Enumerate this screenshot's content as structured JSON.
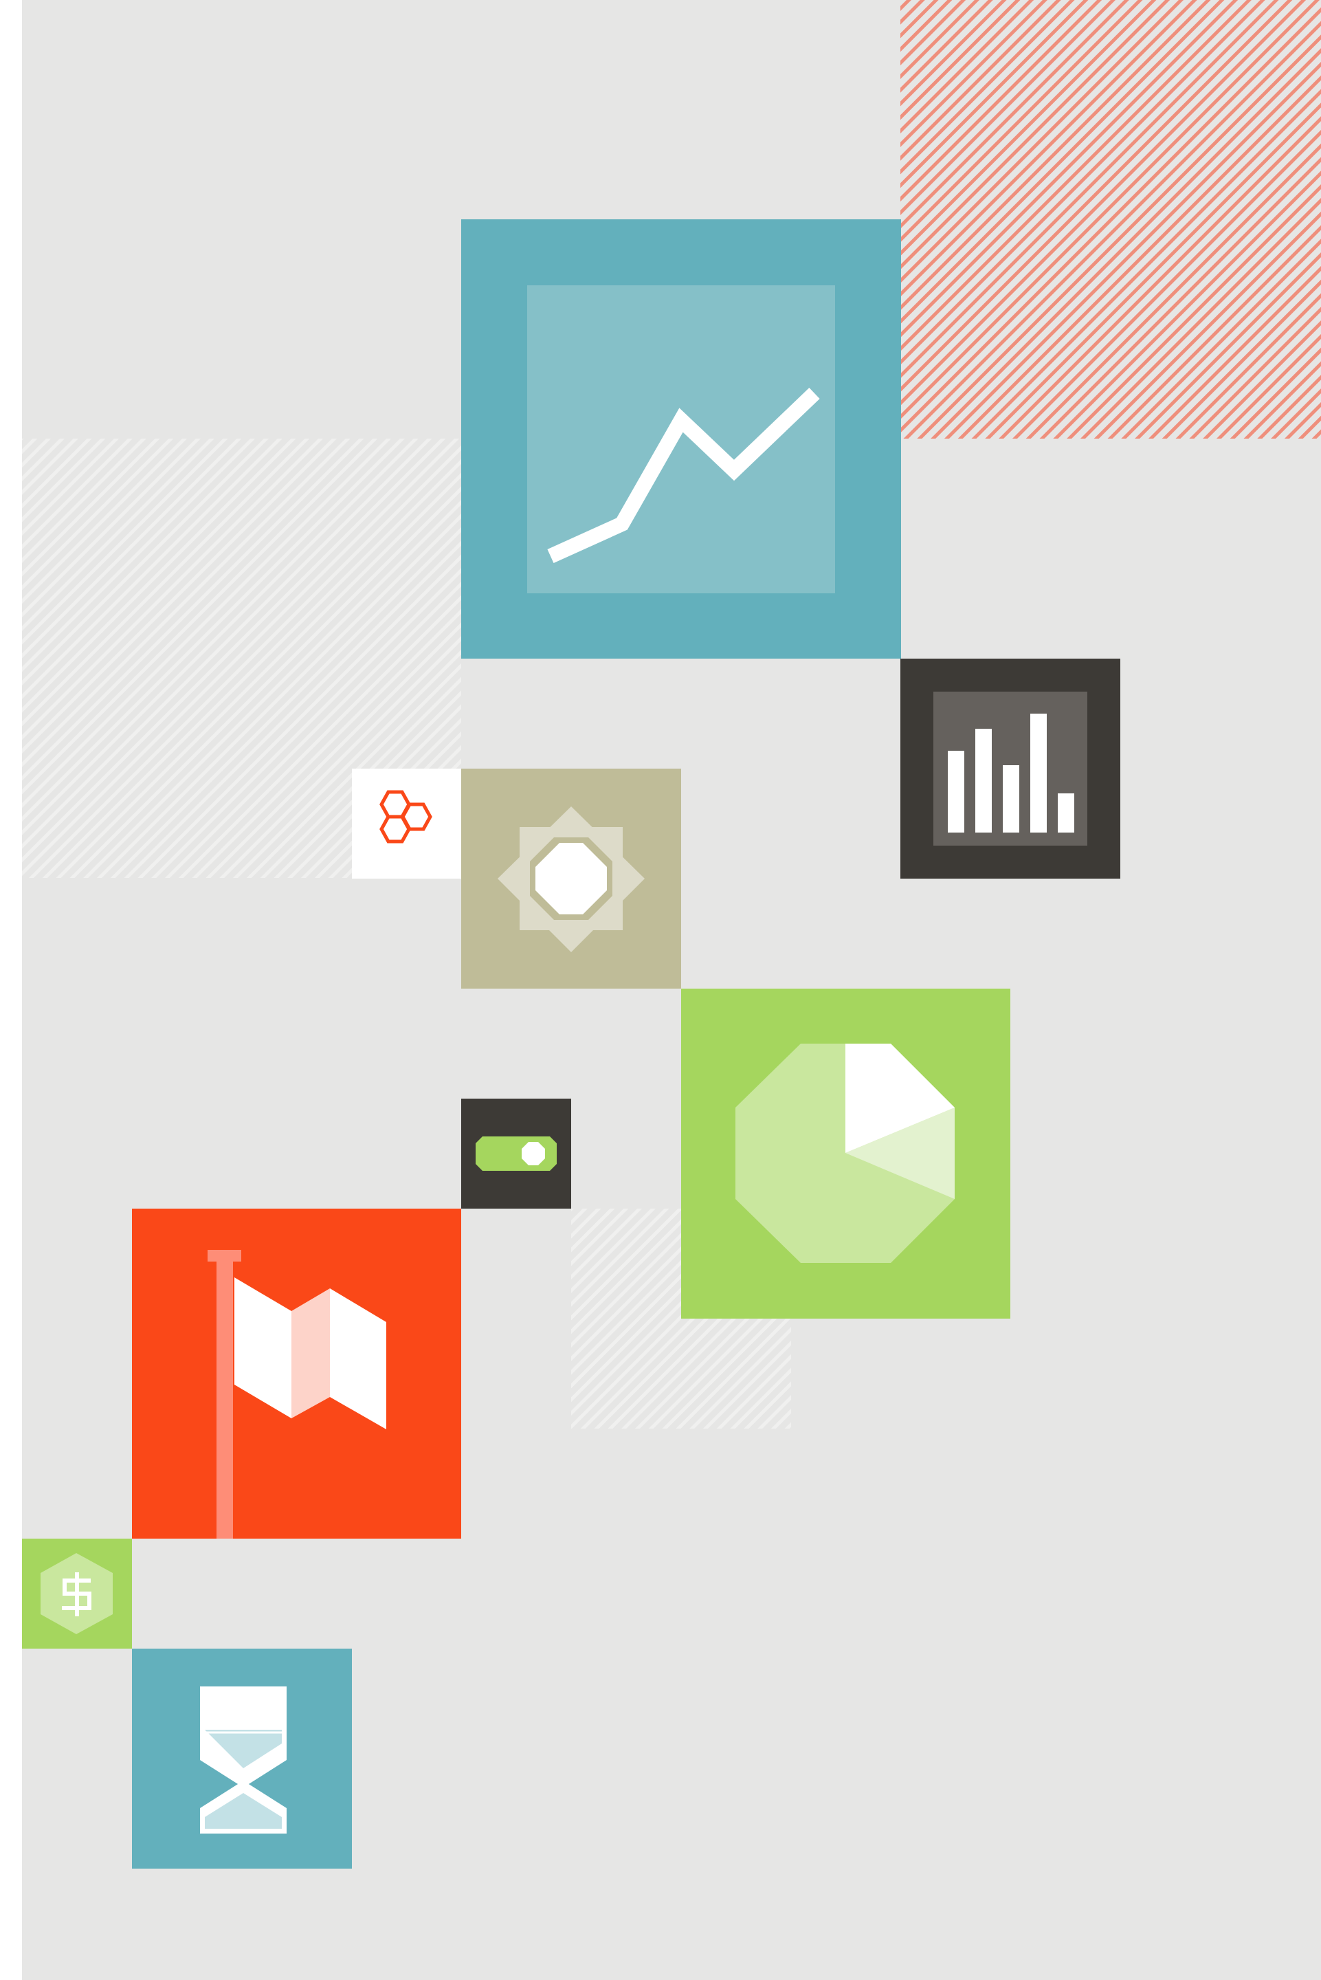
{
  "palette": {
    "background": "#e6e6e5",
    "teal": "#63b0bc",
    "teal_light": "#85c0c8",
    "charcoal": "#3d3a36",
    "charcoal_light": "#65615d",
    "khaki": "#bfbc98",
    "khaki_light": "#dddbc9",
    "green": "#a5d65e",
    "green_light": "#c9e79e",
    "green_pale": "#e3f2cf",
    "orange": "#fa4818",
    "orange_pole": "#fe8d77",
    "flag_pink": "#fdd3c9",
    "coral_stripe": "#ef8f7c",
    "white": "#ffffff"
  },
  "tiles": [
    {
      "name": "line-chart-tile",
      "icon": "line-chart-icon"
    },
    {
      "name": "bar-chart-tile",
      "icon": "bar-chart-icon"
    },
    {
      "name": "hexagon-cluster-tile",
      "icon": "hexagon-cluster-icon"
    },
    {
      "name": "octagon-badge-tile",
      "icon": "octagon-star-icon"
    },
    {
      "name": "toggle-tile",
      "icon": "toggle-switch-icon"
    },
    {
      "name": "pie-chart-tile",
      "icon": "octagon-pie-chart-icon"
    },
    {
      "name": "flag-tile",
      "icon": "flag-icon"
    },
    {
      "name": "dollar-tile",
      "icon": "dollar-hexagon-icon"
    },
    {
      "name": "hourglass-tile",
      "icon": "hourglass-icon"
    }
  ],
  "toggle": {
    "state": "on"
  }
}
